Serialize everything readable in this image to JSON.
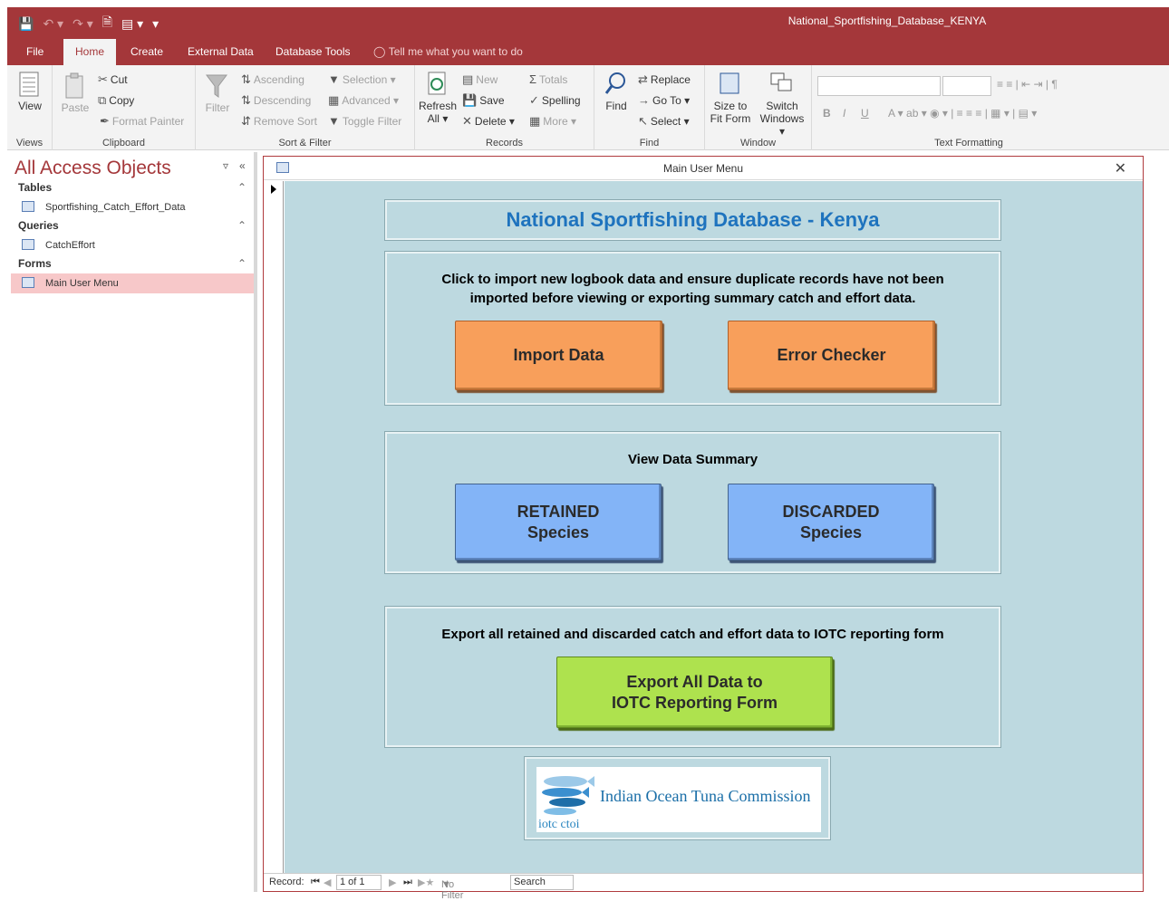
{
  "window": {
    "title": "National_Sportfishing_Database_KENYA"
  },
  "tabs": [
    "File",
    "Home",
    "Create",
    "External Data",
    "Database Tools"
  ],
  "active_tab": "Home",
  "tell_me": "Tell me what you want to do",
  "ribbon": {
    "views": {
      "view": "View",
      "label": "Views"
    },
    "clipboard": {
      "paste": "Paste",
      "cut": "Cut",
      "copy": "Copy",
      "format_painter": "Format Painter",
      "label": "Clipboard"
    },
    "sort_filter": {
      "filter": "Filter",
      "ascending": "Ascending",
      "descending": "Descending",
      "remove_sort": "Remove Sort",
      "selection": "Selection",
      "advanced": "Advanced",
      "toggle_filter": "Toggle Filter",
      "label": "Sort & Filter"
    },
    "records": {
      "refresh": "Refresh",
      "refresh2": "All",
      "new": "New",
      "save": "Save",
      "delete": "Delete",
      "totals": "Totals",
      "spelling": "Spelling",
      "more": "More",
      "label": "Records"
    },
    "find": {
      "find": "Find",
      "replace": "Replace",
      "goto": "Go To",
      "select": "Select",
      "label": "Find"
    },
    "window": {
      "size": "Size to",
      "size2": "Fit Form",
      "switch": "Switch",
      "switch2": "Windows",
      "label": "Window"
    },
    "text_formatting": {
      "label": "Text Formatting"
    }
  },
  "nav": {
    "title": "All Access Objects",
    "sections": [
      {
        "name": "Tables",
        "items": [
          "Sportfishing_Catch_Effort_Data"
        ]
      },
      {
        "name": "Queries",
        "items": [
          "CatchEffort"
        ]
      },
      {
        "name": "Forms",
        "items": [
          "Main User Menu"
        ]
      }
    ]
  },
  "form": {
    "title": "Main User Menu",
    "heading": "National Sportfishing Database - Kenya",
    "import_panel": {
      "text1": "Click to import new logbook data and ensure duplicate records have not been",
      "text2": "imported before viewing or exporting summary catch and effort data.",
      "import_button": "Import Data",
      "error_button": "Error Checker"
    },
    "summary_panel": {
      "text": "View Data Summary",
      "retained_button": "RETAINED\nSpecies",
      "discarded_button": "DISCARDED\nSpecies"
    },
    "export_panel": {
      "text": "Export all retained and discarded catch and effort data to IOTC reporting form",
      "export_button": "Export All Data to\nIOTC Reporting Form"
    },
    "logo": {
      "text": "Indian Ocean Tuna Commission",
      "sub": "iotc ctoi"
    }
  },
  "record_nav": {
    "label": "Record:",
    "position": "1 of 1",
    "filter": "No Filter",
    "search": "Search"
  }
}
